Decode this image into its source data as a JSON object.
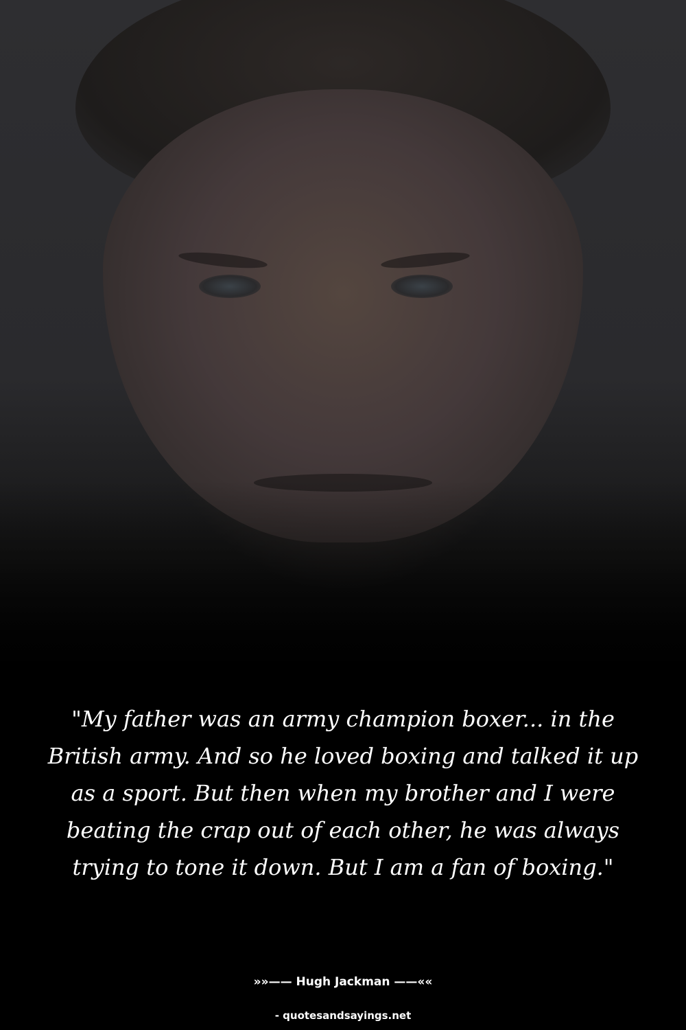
{
  "quote": {
    "text": "\"My father was an army champion boxer... in the British army. And so he loved boxing and talked it up as a sport. But then when my brother and I were beating the crap out of each other, he was always trying to tone it down. But I am a fan of boxing.\"",
    "author": "»»—— Hugh Jackman ——««"
  },
  "footer": {
    "source": "- quotesandsayings.net"
  }
}
